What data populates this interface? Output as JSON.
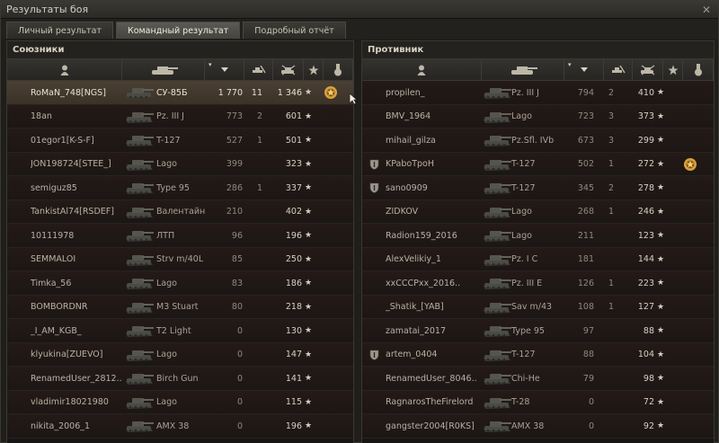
{
  "window": {
    "title": "Результаты боя",
    "close_glyph": "✕"
  },
  "tabs": [
    {
      "label": "Личный результат",
      "active": false
    },
    {
      "label": "Командный результат",
      "active": true
    },
    {
      "label": "Подробный отчёт",
      "active": false
    }
  ],
  "columns": {
    "icons": [
      "player-icon",
      "tank-icon",
      "sort-arrow-icon",
      "frags-icon",
      "damage-icon",
      "xp-star-icon",
      "medal-icon"
    ],
    "sort_glyph": "▾"
  },
  "allies": {
    "header": "Союзники",
    "rows": [
      {
        "player": "RoMaN_748[NGS]",
        "tank": "СУ-85Б",
        "damage": "1 770",
        "frags": "11",
        "xp": "1 346",
        "medal": true,
        "self": true
      },
      {
        "player": "18an",
        "tank": "Pz. III J",
        "damage": "773",
        "frags": "2",
        "xp": "601"
      },
      {
        "player": "01egor1[K-S-F]",
        "tank": "T-127",
        "damage": "527",
        "frags": "1",
        "xp": "501"
      },
      {
        "player": "JON198724[STEE_]",
        "tank": "Lago",
        "damage": "399",
        "frags": "",
        "xp": "323"
      },
      {
        "player": "semiguz85",
        "tank": "Type 95",
        "damage": "286",
        "frags": "1",
        "xp": "337"
      },
      {
        "player": "TankistAl74[RSDEF]",
        "tank": "Валентайн II",
        "damage": "210",
        "frags": "",
        "xp": "402"
      },
      {
        "player": "10111978",
        "tank": "ЛТП",
        "damage": "96",
        "frags": "",
        "xp": "196"
      },
      {
        "player": "SEMMALOI",
        "tank": "Strv m/40L",
        "damage": "85",
        "frags": "",
        "xp": "250"
      },
      {
        "player": "Timka_56",
        "tank": "Lago",
        "damage": "83",
        "frags": "",
        "xp": "186"
      },
      {
        "player": "BOMBORDNR",
        "tank": "M3 Stuart",
        "damage": "80",
        "frags": "",
        "xp": "218"
      },
      {
        "player": "_I_AM_KGB_",
        "tank": "T2 Light",
        "damage": "0",
        "frags": "",
        "xp": "130"
      },
      {
        "player": "klyukina[ZUEVO]",
        "tank": "Lago",
        "damage": "0",
        "frags": "",
        "xp": "147"
      },
      {
        "player": "RenamedUser_2812..",
        "tank": "Birch Gun",
        "damage": "0",
        "frags": "",
        "xp": "141"
      },
      {
        "player": "vladimir18021980",
        "tank": "Lago",
        "damage": "0",
        "frags": "",
        "xp": "115"
      },
      {
        "player": "nikita_2006_1",
        "tank": "AMX 38",
        "damage": "0",
        "frags": "",
        "xp": "196"
      }
    ]
  },
  "enemies": {
    "header": "Противник",
    "rows": [
      {
        "player": "propilen_",
        "tank": "Pz. III J",
        "damage": "794",
        "frags": "2",
        "xp": "410"
      },
      {
        "player": "BMV_1964",
        "tank": "Lago",
        "damage": "723",
        "frags": "3",
        "xp": "373"
      },
      {
        "player": "mihail_gilza",
        "tank": "Pz.Sfl. IVb",
        "damage": "673",
        "frags": "3",
        "xp": "299"
      },
      {
        "player": "KPaboTpoH",
        "tank": "T-127",
        "damage": "502",
        "frags": "1",
        "xp": "272",
        "medal": true,
        "platoon": true
      },
      {
        "player": "sano0909",
        "tank": "T-127",
        "damage": "345",
        "frags": "2",
        "xp": "278",
        "platoon": true
      },
      {
        "player": "ZIDKOV",
        "tank": "Lago",
        "damage": "268",
        "frags": "1",
        "xp": "246"
      },
      {
        "player": "Radion159_2016",
        "tank": "Lago",
        "damage": "211",
        "frags": "",
        "xp": "123"
      },
      {
        "player": "AlexVelikiy_1",
        "tank": "Pz. I C",
        "damage": "181",
        "frags": "",
        "xp": "144"
      },
      {
        "player": "xxCCCPxx_2016..",
        "tank": "Pz. III E",
        "damage": "126",
        "frags": "1",
        "xp": "223"
      },
      {
        "player": "_Shatik_[YAB]",
        "tank": "Sav m/43",
        "damage": "108",
        "frags": "1",
        "xp": "127"
      },
      {
        "player": "zamatai_2017",
        "tank": "Type 95",
        "damage": "97",
        "frags": "",
        "xp": "88"
      },
      {
        "player": "artem_0404",
        "tank": "T-127",
        "damage": "88",
        "frags": "",
        "xp": "104",
        "platoon": true
      },
      {
        "player": "RenamedUser_8046..",
        "tank": "Chi-He",
        "damage": "79",
        "frags": "",
        "xp": "98"
      },
      {
        "player": "RagnarosTheFirelord",
        "tank": "T-28",
        "damage": "0",
        "frags": "",
        "xp": "72"
      },
      {
        "player": "gangster2004[R0KS]",
        "tank": "AMX 38",
        "damage": "0",
        "frags": "",
        "xp": "92"
      }
    ]
  },
  "colors": {
    "row_bg": "#241a17",
    "self_row_bg": "#4a3f33",
    "text": "#b8b2a4",
    "medal": "#d9a23a"
  }
}
